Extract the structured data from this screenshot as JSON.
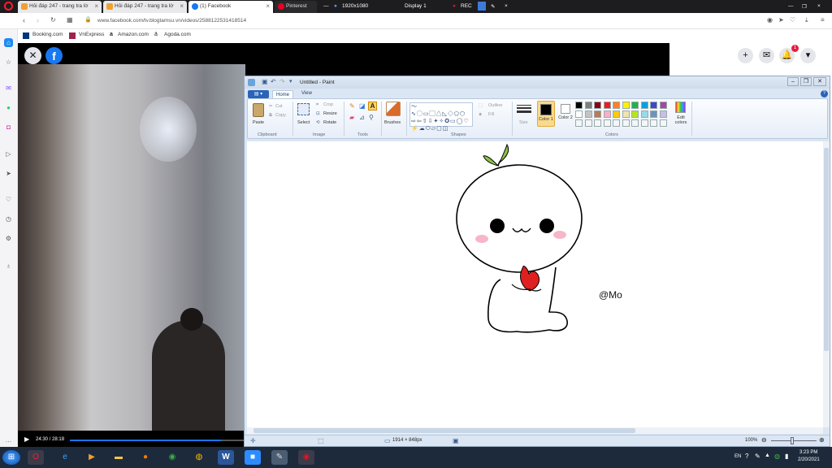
{
  "browser": {
    "tabs": [
      {
        "label": "Hỏi đáp 247 - trang tra lờ",
        "icon_color": "#f0a030"
      },
      {
        "label": "Hỏi đáp 247 - trang tra lờ",
        "icon_color": "#f0a030"
      },
      {
        "label": "(1) Facebook",
        "icon_color": "#1877f2"
      },
      {
        "label": "Pinterest",
        "icon_color": "#e60023"
      }
    ],
    "recorder": {
      "resolution": "1920x1080",
      "display": "Display 1",
      "rec": "REC"
    },
    "url": "www.facebook.com/tv.blogtamsu.vn/videos/2588122531418514",
    "bookmarks": [
      "Booking.com",
      "VnExpress",
      "Amazon.com",
      "Agoda.com"
    ],
    "sidebar_icons": [
      "home-icon",
      "messenger-icon",
      "whatsapp-icon",
      "instagram-icon",
      "player-icon",
      "send-icon",
      "heart-icon",
      "history-icon",
      "settings-icon",
      "bulb-icon",
      "more-icon"
    ]
  },
  "facebook": {
    "notification_count": "1",
    "video_time": "24:30 / 28:18",
    "progress": 0.87
  },
  "paint": {
    "title": "Untitled - Paint",
    "tabs": [
      "Home",
      "View"
    ],
    "groups": [
      "Clipboard",
      "Image",
      "Tools",
      "Shapes",
      "Colors"
    ],
    "buttons": {
      "paste": "Paste",
      "cut": "Cut",
      "copy": "Copy",
      "select": "Select",
      "crop": "Crop",
      "resize": "Resize",
      "rotate": "Rotate",
      "brushes": "Brushes",
      "outline": "Outline",
      "fill": "Fill",
      "size": "Size",
      "color1": "Color 1",
      "color2": "Color 2",
      "edit_colors": "Edit colors"
    },
    "palette": [
      "#000000",
      "#7f7f7f",
      "#880015",
      "#ed1c24",
      "#ff7f27",
      "#fff200",
      "#22b14c",
      "#00a2e8",
      "#3f48cc",
      "#a349a4",
      "#ffffff",
      "#c3c3c3",
      "#b97a57",
      "#ffaec9",
      "#ffc90e",
      "#efe4b0",
      "#b5e61d",
      "#99d9ea",
      "#7092be",
      "#c8bfe7"
    ],
    "signature": "@Mo",
    "status": {
      "size": "1914 × 848px",
      "zoom": "100%"
    }
  },
  "taskbar": {
    "time": "3:23 PM",
    "date": "2/20/2021",
    "lang": "EN"
  }
}
